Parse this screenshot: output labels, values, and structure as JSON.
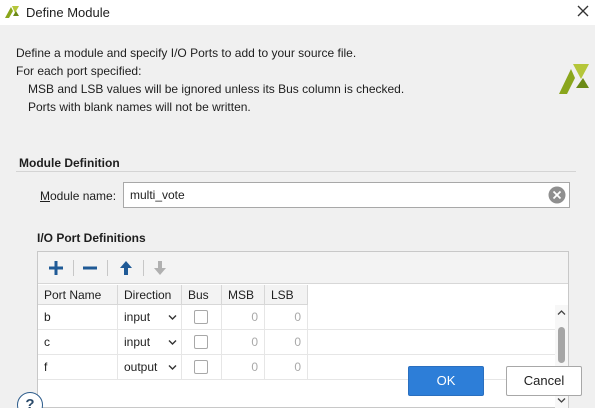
{
  "window": {
    "title": "Define Module",
    "app_icon": "vivado-logo-icon",
    "close_icon": "close-icon"
  },
  "description": {
    "line1": "Define a module and specify I/O Ports to add to your source file.",
    "line2": "For each port specified:",
    "line3": "MSB and LSB values will be ignored unless its Bus column is checked.",
    "line4": "Ports with blank names will not be written."
  },
  "module_definition": {
    "heading": "Module Definition",
    "name_label_first": "M",
    "name_label_rest": "odule name:",
    "name_value": "multi_vote"
  },
  "io_ports": {
    "heading": "I/O Port Definitions",
    "toolbar": [
      "add-icon",
      "remove-icon",
      "move-up-icon",
      "move-down-icon"
    ],
    "columns": [
      "Port Name",
      "Direction",
      "Bus",
      "MSB",
      "LSB"
    ],
    "rows": [
      {
        "name": "b",
        "direction": "input",
        "bus": false,
        "msb": "0",
        "lsb": "0"
      },
      {
        "name": "c",
        "direction": "input",
        "bus": false,
        "msb": "0",
        "lsb": "0"
      },
      {
        "name": "f",
        "direction": "output",
        "bus": false,
        "msb": "0",
        "lsb": "0"
      }
    ]
  },
  "footer": {
    "help_label": "?",
    "ok_label": "OK",
    "cancel_label": "Cancel"
  },
  "colors": {
    "accent": "#2d7ed8",
    "icon_blue": "#1f5a96",
    "logo_green": "#8aa61c"
  }
}
